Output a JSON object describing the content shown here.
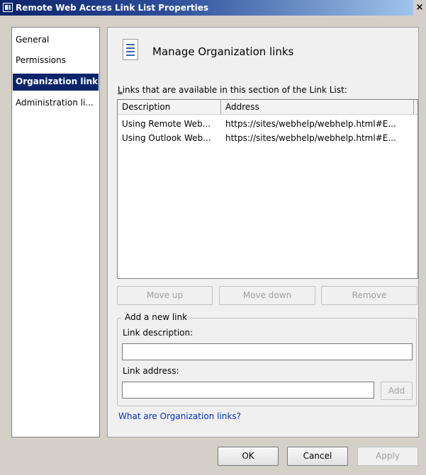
{
  "window": {
    "title": "Remote Web Access Link List Properties",
    "close_glyph": "×"
  },
  "nav": {
    "items": [
      {
        "label": "General"
      },
      {
        "label": "Permissions"
      },
      {
        "label": "Organization links"
      },
      {
        "label": "Administration li..."
      }
    ],
    "selected": "Organization links"
  },
  "content": {
    "page_title": "Manage Organization links",
    "list_label": "Links that are available in this section of the Link List:",
    "columns": [
      "Description",
      "Address"
    ],
    "rows": [
      {
        "description": "Using Remote Web...",
        "address": "https://sites/webhelp/webhelp.html#E..."
      },
      {
        "description": "Using Outlook Web...",
        "address": "https://sites/webhelp/webhelp.html#E..."
      }
    ],
    "buttons": {
      "move_up": "Move up",
      "move_down": "Move down",
      "remove": "Remove"
    },
    "new_link": {
      "group_title": "Add a new link",
      "description_label": "Link description:",
      "description_value": "",
      "address_label": "Link address:",
      "address_value": "",
      "add_button": "Add"
    },
    "help_link": "What are Organization links?"
  },
  "footer": {
    "ok": "OK",
    "cancel": "Cancel",
    "apply": "Apply"
  },
  "colors": {
    "selection": "#0a246a",
    "link": "#0033cc",
    "disabled_text": "#a0a0a0"
  }
}
